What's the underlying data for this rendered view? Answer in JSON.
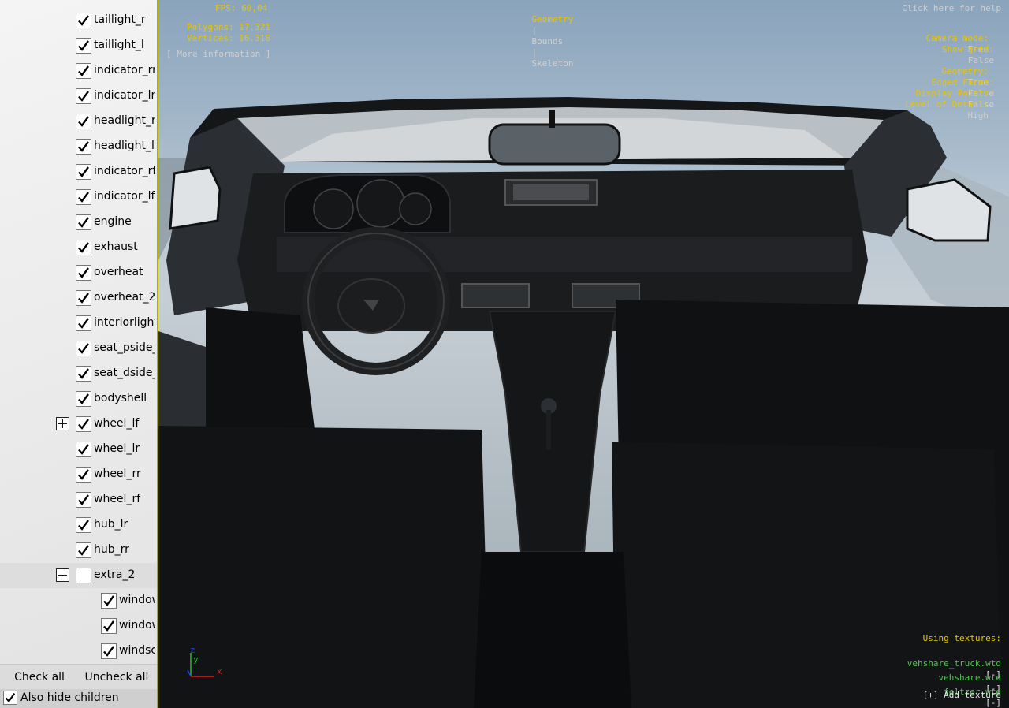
{
  "tree": {
    "items": [
      {
        "label": "taillight_r",
        "checked": true,
        "expander": "none",
        "indent": 0
      },
      {
        "label": "taillight_l",
        "checked": true,
        "expander": "none",
        "indent": 0
      },
      {
        "label": "indicator_rr",
        "checked": true,
        "expander": "none",
        "indent": 0
      },
      {
        "label": "indicator_lr",
        "checked": true,
        "expander": "none",
        "indent": 0
      },
      {
        "label": "headlight_r",
        "checked": true,
        "expander": "none",
        "indent": 0
      },
      {
        "label": "headlight_l",
        "checked": true,
        "expander": "none",
        "indent": 0
      },
      {
        "label": "indicator_rf",
        "checked": true,
        "expander": "none",
        "indent": 0
      },
      {
        "label": "indicator_lf",
        "checked": true,
        "expander": "none",
        "indent": 0
      },
      {
        "label": "engine",
        "checked": true,
        "expander": "none",
        "indent": 0
      },
      {
        "label": "exhaust",
        "checked": true,
        "expander": "none",
        "indent": 0
      },
      {
        "label": "overheat",
        "checked": true,
        "expander": "none",
        "indent": 0
      },
      {
        "label": "overheat_2",
        "checked": true,
        "expander": "none",
        "indent": 0
      },
      {
        "label": "interiorlight",
        "checked": true,
        "expander": "none",
        "indent": 0
      },
      {
        "label": "seat_pside_r",
        "checked": true,
        "expander": "none",
        "indent": 0
      },
      {
        "label": "seat_dside_r",
        "checked": true,
        "expander": "none",
        "indent": 0
      },
      {
        "label": "bodyshell",
        "checked": true,
        "expander": "none",
        "indent": 0
      },
      {
        "label": "wheel_lf",
        "checked": true,
        "expander": "plus",
        "indent": 0
      },
      {
        "label": "wheel_lr",
        "checked": true,
        "expander": "none",
        "indent": 0
      },
      {
        "label": "wheel_rr",
        "checked": true,
        "expander": "none",
        "indent": 0
      },
      {
        "label": "wheel_rf",
        "checked": true,
        "expander": "none",
        "indent": 0
      },
      {
        "label": "hub_lr",
        "checked": true,
        "expander": "none",
        "indent": 0
      },
      {
        "label": "hub_rr",
        "checked": true,
        "expander": "none",
        "indent": 0
      },
      {
        "label": "extra_2",
        "checked": false,
        "expander": "minus",
        "indent": 0,
        "selected": true
      },
      {
        "label": "window_lf",
        "checked": true,
        "expander": "none",
        "indent": 1
      },
      {
        "label": "window_rf",
        "checked": true,
        "expander": "none",
        "indent": 1
      },
      {
        "label": "windscreen",
        "checked": true,
        "expander": "none",
        "indent": 1
      }
    ]
  },
  "bottom": {
    "check_all": "Check all",
    "uncheck_all": "Uncheck all",
    "hide_children": "Also hide children",
    "hide_children_checked": true
  },
  "hud": {
    "fps": "FPS: 60,04",
    "polygons": "Polygons: 17.321",
    "vertices": "Vertices: 16.318",
    "more_info": "[ More information ]",
    "tab_geometry": "Geometry",
    "sep1": "|",
    "tab_bounds": "Bounds",
    "sep2": "|",
    "tab_skeleton": "Skeleton",
    "help": "Click here for help",
    "camera_mode_label": "Camera mode:",
    "camera_mode_value": "Free",
    "show_grid_label": "Show grid:",
    "show_grid_value": "False",
    "geometry_label": "Geometry:",
    "geometry_value": "True",
    "edged_faces_label": "Edged Faces:",
    "edged_faces_value": "False",
    "display_points_label": "Display Points:",
    "display_points_value": "False",
    "lod_label": "Level of Detail:",
    "lod_value": "High",
    "using_textures": "Using textures:",
    "textures": [
      {
        "name": "vehshare_truck.wtd",
        "remove": "[-]"
      },
      {
        "name": "vehshare.wtd",
        "remove": "[-]"
      },
      {
        "name": "feltzer.wtd",
        "remove": "[-]"
      }
    ],
    "add_texture": "[+] Add texture",
    "axis_x": "x",
    "axis_y": "y",
    "axis_z": "z"
  },
  "colors": {
    "hud_yellow": "#e8c400",
    "hud_green": "#4ec84e",
    "hud_gray": "#cfcfcf",
    "axis_x": "#d02020",
    "axis_y": "#20c020",
    "axis_z": "#2040e0"
  }
}
